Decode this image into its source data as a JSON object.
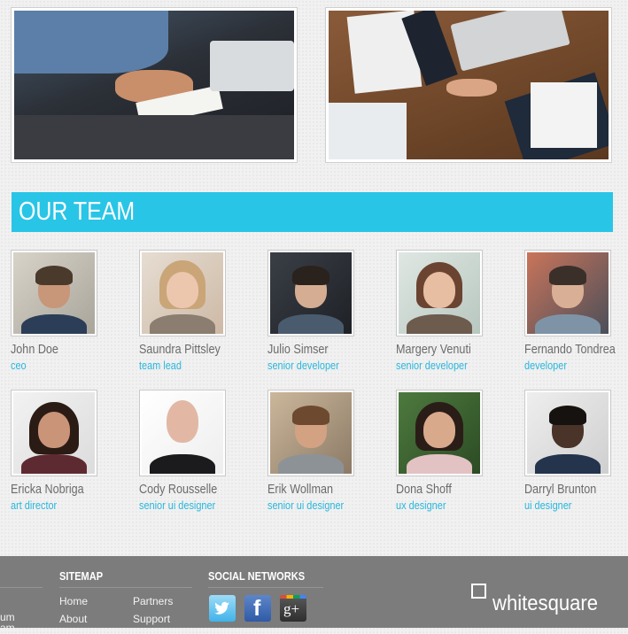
{
  "section": {
    "title": "OUR TEAM"
  },
  "team": [
    {
      "name": "John Doe",
      "role": "ceo"
    },
    {
      "name": "Saundra Pittsley",
      "role": "team lead"
    },
    {
      "name": "Julio Simser",
      "role": "senior developer"
    },
    {
      "name": "Margery Venuti",
      "role": "senior developer"
    },
    {
      "name": "Fernando Tondrea",
      "role": "developer"
    },
    {
      "name": "Ericka Nobriga",
      "role": "art director"
    },
    {
      "name": "Cody Rousselle",
      "role": "senior ui designer"
    },
    {
      "name": "Erik Wollman",
      "role": "senior ui designer"
    },
    {
      "name": "Dona Shoff",
      "role": "ux designer"
    },
    {
      "name": "Darryl Brunton",
      "role": "ui designer"
    }
  ],
  "footer": {
    "left_partial_1": "um",
    "left_partial_2": "am",
    "sitemap": {
      "heading": "SITEMAP",
      "links": [
        "Home",
        "About",
        "Partners",
        "Support"
      ]
    },
    "social": {
      "heading": "SOCIAL NETWORKS",
      "icons": [
        "twitter-icon",
        "facebook-icon",
        "google-plus-icon"
      ],
      "facebook_glyph": "f",
      "google_glyph": "g+"
    },
    "brand": "whitesquare"
  },
  "colors": {
    "accent": "#29c5e6",
    "role_text": "#29b7dc",
    "footer_bg": "#7c7c7c"
  }
}
